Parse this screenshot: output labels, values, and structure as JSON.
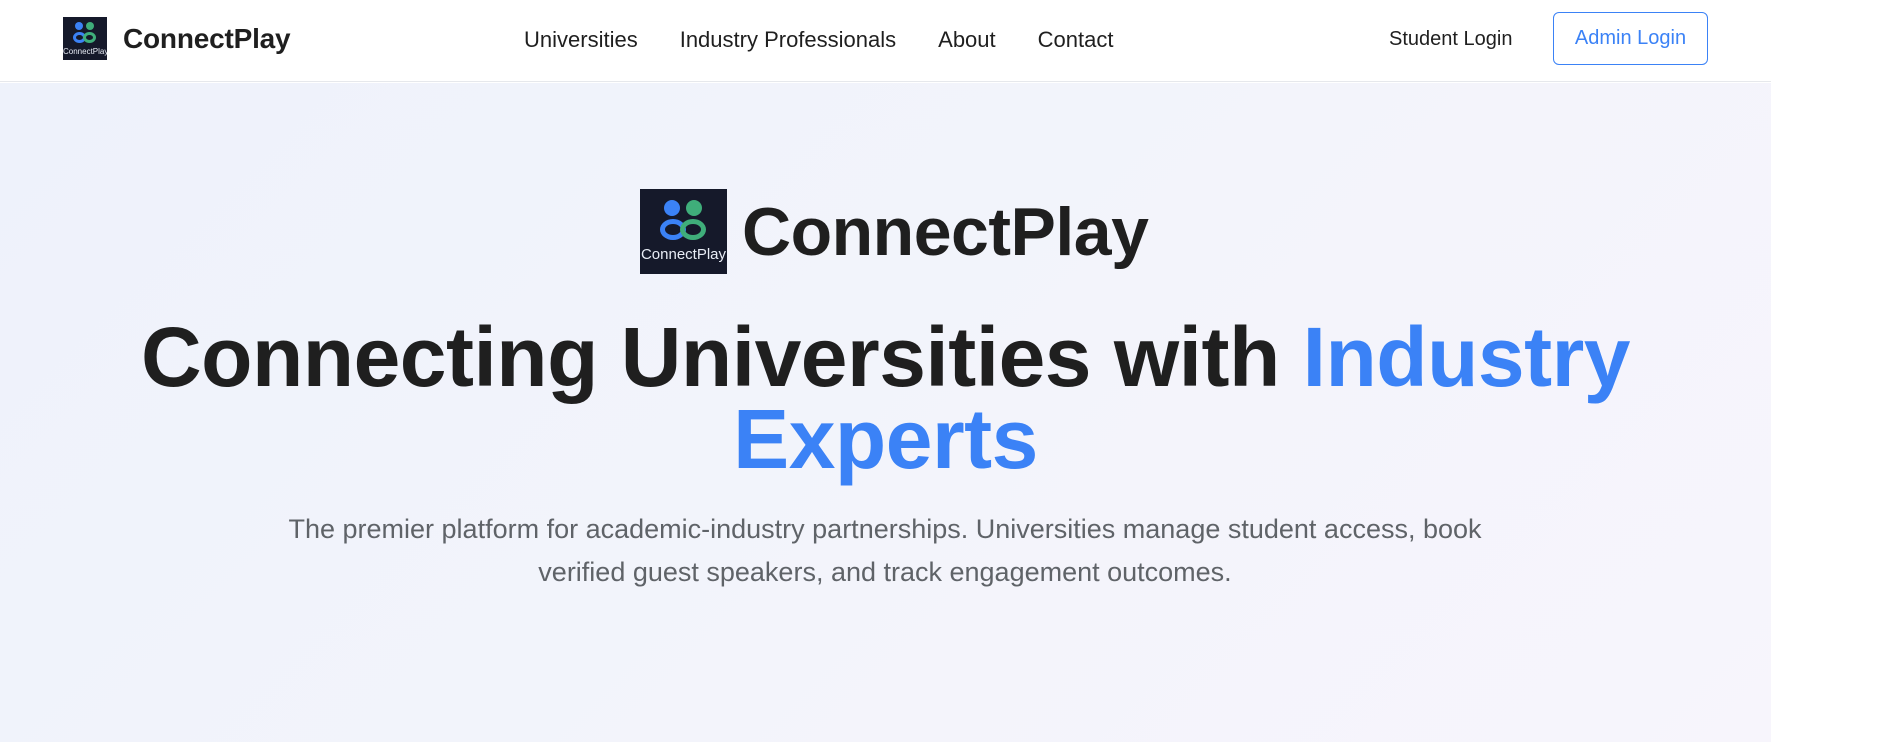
{
  "header": {
    "brand_name": "ConnectPlay",
    "logo_caption": "ConnectPlay",
    "logo_icon": "connectplay-logo-icon",
    "nav": [
      {
        "label": "Universities"
      },
      {
        "label": "Industry Professionals"
      },
      {
        "label": "About"
      },
      {
        "label": "Contact"
      }
    ],
    "student_login_label": "Student Login",
    "admin_login_label": "Admin Login"
  },
  "hero": {
    "brand_name": "ConnectPlay",
    "logo_caption": "ConnectPlay",
    "title_prefix": "Connecting Universities with ",
    "title_highlight": "Industry Experts",
    "subtitle": "The premier platform for academic-industry partnerships. Universities manage student access, book verified guest speakers, and track engagement outcomes."
  },
  "colors": {
    "accent": "#3b82f6",
    "logo_bg": "#15192a",
    "logo_blue": "#3b82f6",
    "logo_green": "#3fae7a",
    "text": "#1f1f1f",
    "muted_text": "#5f6368"
  }
}
